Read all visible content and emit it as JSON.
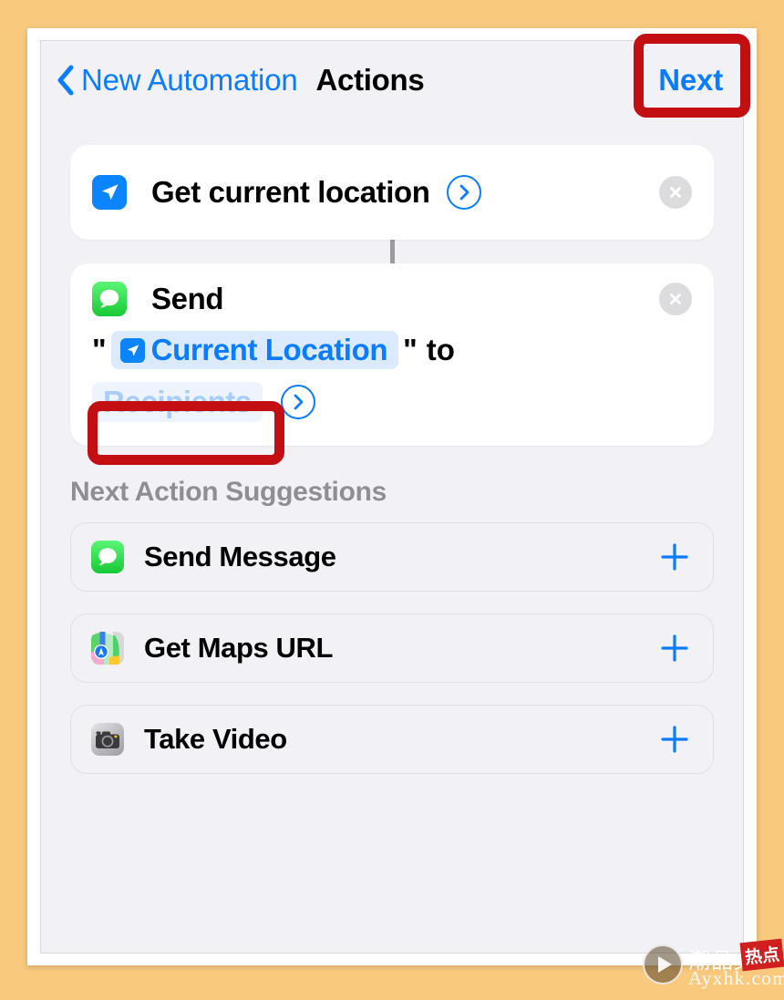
{
  "nav": {
    "back_icon": "chevron-left-icon",
    "back_label": "New Automation",
    "title": "Actions",
    "next_label": "Next"
  },
  "colors": {
    "page_background": "#f9c97e",
    "screen_background": "#f1f1f6",
    "accent_blue": "#0a7cff",
    "annotation_red": "#c40f12",
    "token_blue_bg": "#dbeafe",
    "placeholder_blue": "#a8cdf8",
    "messages_green": "#16c935",
    "location_blue": "#0a84ff",
    "muted_gray": "#8e8e93"
  },
  "actions": [
    {
      "id": "get-current-location",
      "icon": "location-arrow-icon",
      "title": "Get current location",
      "has_chevron": true,
      "chevron_icon": "chevron-right-circle-icon",
      "remove_icon": "close-circle-icon"
    },
    {
      "id": "send-message",
      "icon": "messages-icon",
      "title": "Send",
      "remove_icon": "close-circle-icon",
      "quote_open": "\"",
      "quote_close": "\"",
      "variable_token": {
        "icon": "location-arrow-icon",
        "label": "Current Location"
      },
      "connector_word": "to",
      "recipients_placeholder": "Recipients",
      "chevron_icon": "chevron-right-circle-icon"
    }
  ],
  "suggestions": {
    "header": "Next Action Suggestions",
    "items": [
      {
        "icon": "messages-icon",
        "label": "Send Message",
        "add_icon": "plus-icon"
      },
      {
        "icon": "maps-icon",
        "label": "Get Maps URL",
        "add_icon": "plus-icon"
      },
      {
        "icon": "camera-icon",
        "label": "Take Video",
        "add_icon": "plus-icon"
      }
    ]
  },
  "annotations": [
    {
      "id": "next-button-highlight",
      "target": "Next"
    },
    {
      "id": "recipients-highlight",
      "target": "Recipients"
    }
  ],
  "watermark": {
    "play_icon": "play-circle-icon",
    "cn_text": "潮品文",
    "badge_text": "热点",
    "url": "Ayxhk.com"
  }
}
